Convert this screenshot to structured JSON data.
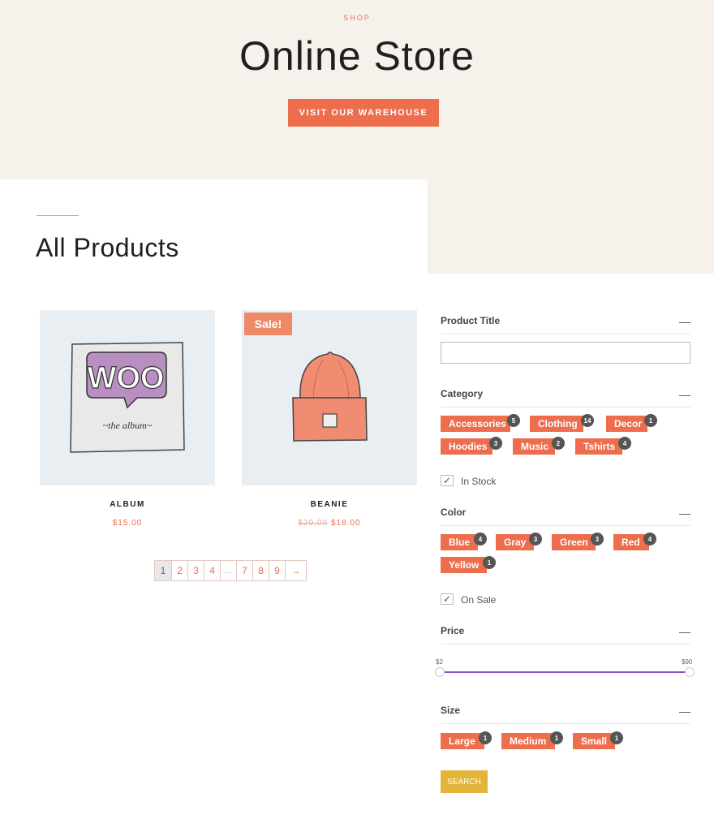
{
  "hero": {
    "eyebrow": "SHOP",
    "title": "Online Store",
    "button_label": "VISIT OUR WAREHOUSE"
  },
  "section": {
    "title": "All Products"
  },
  "products": [
    {
      "name": "ALBUM",
      "price": "$15.00",
      "old_price": "",
      "sale_label": ""
    },
    {
      "name": "BEANIE",
      "price": "$18.00",
      "old_price": "$20.00",
      "sale_label": "Sale!"
    }
  ],
  "album_art": {
    "logo_text": "WOO",
    "caption": "~the album~"
  },
  "pagination": {
    "pages": [
      "1",
      "2",
      "3",
      "4",
      "…",
      "7",
      "8",
      "9",
      "→"
    ],
    "current": "1"
  },
  "filters": {
    "product_title": {
      "label": "Product Title",
      "toggle": "—",
      "value": ""
    },
    "category": {
      "label": "Category",
      "toggle": "—",
      "items": [
        {
          "name": "Accessories",
          "count": "5"
        },
        {
          "name": "Clothing",
          "count": "14"
        },
        {
          "name": "Decor",
          "count": "1"
        },
        {
          "name": "Hoodies",
          "count": "3"
        },
        {
          "name": "Music",
          "count": "2"
        },
        {
          "name": "Tshirts",
          "count": "4"
        }
      ]
    },
    "in_stock": {
      "label": "In Stock",
      "checked": true,
      "mark": "✓"
    },
    "color": {
      "label": "Color",
      "toggle": "—",
      "items": [
        {
          "name": "Blue",
          "count": "4"
        },
        {
          "name": "Gray",
          "count": "3"
        },
        {
          "name": "Green",
          "count": "3"
        },
        {
          "name": "Red",
          "count": "4"
        },
        {
          "name": "Yellow",
          "count": "1"
        }
      ]
    },
    "on_sale": {
      "label": "On Sale",
      "checked": true,
      "mark": "✓"
    },
    "price": {
      "label": "Price",
      "toggle": "—",
      "min_label": "$2",
      "max_label": "$90"
    },
    "size": {
      "label": "Size",
      "toggle": "—",
      "items": [
        {
          "name": "Large",
          "count": "1"
        },
        {
          "name": "Medium",
          "count": "1"
        },
        {
          "name": "Small",
          "count": "1"
        }
      ]
    },
    "search_label": "SEARCH"
  },
  "colors": {
    "accent": "#ee6d4c",
    "hero_bg": "#f7f1eb",
    "search_button": "#e2b43a",
    "slider": "#8a4fc9",
    "badge": "#555555"
  }
}
